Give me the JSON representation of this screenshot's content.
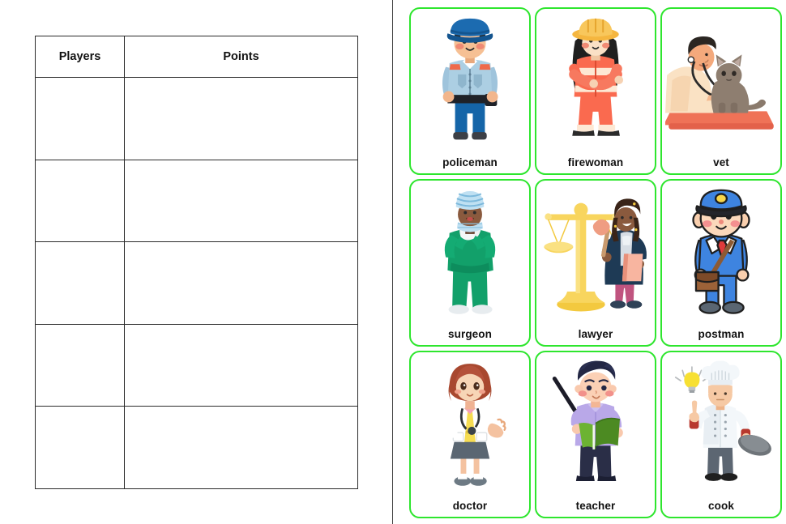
{
  "scoreboard": {
    "columns": [
      "Players",
      "Points"
    ],
    "rows": [
      {
        "player": "",
        "points": ""
      },
      {
        "player": "",
        "points": ""
      },
      {
        "player": "",
        "points": ""
      },
      {
        "player": "",
        "points": ""
      },
      {
        "player": "",
        "points": ""
      }
    ],
    "row_count": 5,
    "border_color": "#2b2b2b"
  },
  "divider": {
    "color": "#3d3d3d"
  },
  "flashcards": {
    "border_color": "#2ee62e",
    "columns": 3,
    "rows": 3,
    "items": [
      {
        "label": "policeman",
        "icon": "policeman-illustration"
      },
      {
        "label": "firewoman",
        "icon": "firewoman-illustration"
      },
      {
        "label": "vet",
        "icon": "vet-illustration"
      },
      {
        "label": "surgeon",
        "icon": "surgeon-illustration"
      },
      {
        "label": "lawyer",
        "icon": "lawyer-illustration"
      },
      {
        "label": "postman",
        "icon": "postman-illustration"
      },
      {
        "label": "doctor",
        "icon": "doctor-illustration"
      },
      {
        "label": "teacher",
        "icon": "teacher-illustration"
      },
      {
        "label": "cook",
        "icon": "cook-illustration"
      }
    ]
  }
}
